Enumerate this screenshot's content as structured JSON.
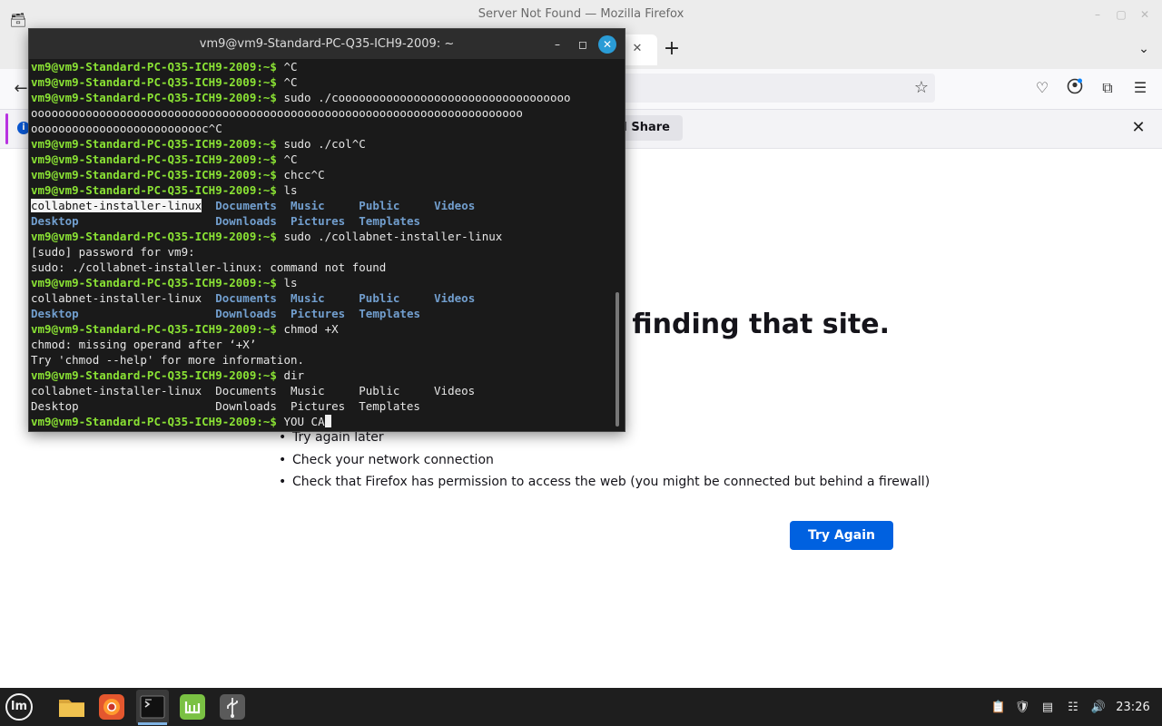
{
  "firefox": {
    "window_title": "Server Not Found — Mozilla Firefox",
    "notification_button": "t I Share",
    "error_title": "le finding that site.",
    "suggestions": [
      "Try again later",
      "Check your network connection",
      "Check that Firefox has permission to access the web (you might be connected but behind a firewall)"
    ],
    "try_again_label": "Try Again"
  },
  "terminal": {
    "title": "vm9@vm9-Standard-PC-Q35-ICH9-2009: ~",
    "prompt": "vm9@vm9-Standard-PC-Q35-ICH9-2009:~$ ",
    "lines": [
      {
        "segments": [
          {
            "t": "vm9@vm9-Standard-PC-Q35-ICH9-2009:~$ ",
            "k": "prompt"
          },
          {
            "t": "^C"
          }
        ]
      },
      {
        "segments": [
          {
            "t": "vm9@vm9-Standard-PC-Q35-ICH9-2009:~$ ",
            "k": "prompt"
          },
          {
            "t": "^C"
          }
        ]
      },
      {
        "segments": [
          {
            "t": "vm9@vm9-Standard-PC-Q35-ICH9-2009:~$ ",
            "k": "prompt"
          },
          {
            "t": "sudo ./coooooooooooooooooooooooooooooooooo"
          }
        ]
      },
      {
        "segments": [
          {
            "t": "oooooooooooooooooooooooooooooooooooooooooooooooooooooooooooooooooooooooo"
          }
        ]
      },
      {
        "segments": [
          {
            "t": "oooooooooooooooooooooooooc^C"
          }
        ]
      },
      {
        "segments": [
          {
            "t": "vm9@vm9-Standard-PC-Q35-ICH9-2009:~$ ",
            "k": "prompt"
          },
          {
            "t": "sudo ./col^C"
          }
        ]
      },
      {
        "segments": [
          {
            "t": "vm9@vm9-Standard-PC-Q35-ICH9-2009:~$ ",
            "k": "prompt"
          },
          {
            "t": "^C"
          }
        ]
      },
      {
        "segments": [
          {
            "t": "vm9@vm9-Standard-PC-Q35-ICH9-2009:~$ ",
            "k": "prompt"
          },
          {
            "t": "chcc^C"
          }
        ]
      },
      {
        "segments": [
          {
            "t": "vm9@vm9-Standard-PC-Q35-ICH9-2009:~$ ",
            "k": "prompt"
          },
          {
            "t": "ls"
          }
        ]
      },
      {
        "segments": [
          {
            "t": "collabnet-installer-linux",
            "k": "hl"
          },
          {
            "t": "  "
          },
          {
            "t": "Documents",
            "k": "dir"
          },
          {
            "t": "  "
          },
          {
            "t": "Music",
            "k": "dir"
          },
          {
            "t": "     "
          },
          {
            "t": "Public",
            "k": "dir"
          },
          {
            "t": "     "
          },
          {
            "t": "Videos",
            "k": "dir"
          }
        ]
      },
      {
        "segments": [
          {
            "t": "Desktop",
            "k": "dir"
          },
          {
            "t": "                    "
          },
          {
            "t": "Downloads",
            "k": "dir"
          },
          {
            "t": "  "
          },
          {
            "t": "Pictures",
            "k": "dir"
          },
          {
            "t": "  "
          },
          {
            "t": "Templates",
            "k": "dir"
          }
        ]
      },
      {
        "segments": [
          {
            "t": "vm9@vm9-Standard-PC-Q35-ICH9-2009:~$ ",
            "k": "prompt"
          },
          {
            "t": "sudo ./collabnet-installer-linux"
          }
        ]
      },
      {
        "segments": [
          {
            "t": "[sudo] password for vm9:"
          }
        ]
      },
      {
        "segments": [
          {
            "t": "sudo: ./collabnet-installer-linux: command not found"
          }
        ]
      },
      {
        "segments": [
          {
            "t": "vm9@vm9-Standard-PC-Q35-ICH9-2009:~$ ",
            "k": "prompt"
          },
          {
            "t": "ls"
          }
        ]
      },
      {
        "segments": [
          {
            "t": "collabnet-installer-linux  "
          },
          {
            "t": "Documents",
            "k": "dir"
          },
          {
            "t": "  "
          },
          {
            "t": "Music",
            "k": "dir"
          },
          {
            "t": "     "
          },
          {
            "t": "Public",
            "k": "dir"
          },
          {
            "t": "     "
          },
          {
            "t": "Videos",
            "k": "dir"
          }
        ]
      },
      {
        "segments": [
          {
            "t": "Desktop",
            "k": "dir"
          },
          {
            "t": "                    "
          },
          {
            "t": "Downloads",
            "k": "dir"
          },
          {
            "t": "  "
          },
          {
            "t": "Pictures",
            "k": "dir"
          },
          {
            "t": "  "
          },
          {
            "t": "Templates",
            "k": "dir"
          }
        ]
      },
      {
        "segments": [
          {
            "t": "vm9@vm9-Standard-PC-Q35-ICH9-2009:~$ ",
            "k": "prompt"
          },
          {
            "t": "chmod +X"
          }
        ]
      },
      {
        "segments": [
          {
            "t": "chmod: missing operand after ‘+X’"
          }
        ]
      },
      {
        "segments": [
          {
            "t": "Try 'chmod --help' for more information."
          }
        ]
      },
      {
        "segments": [
          {
            "t": "vm9@vm9-Standard-PC-Q35-ICH9-2009:~$ ",
            "k": "prompt"
          },
          {
            "t": "dir"
          }
        ]
      },
      {
        "segments": [
          {
            "t": "collabnet-installer-linux  Documents  Music     Public     Videos"
          }
        ]
      },
      {
        "segments": [
          {
            "t": "Desktop                    Downloads  Pictures  Templates"
          }
        ]
      }
    ],
    "current_input": "YOU CA"
  },
  "taskbar": {
    "menu_logo_text": "lm",
    "launchers": [
      "files-icon",
      "firefox-icon",
      "terminal-icon",
      "mint-update-icon",
      "usb-icon"
    ],
    "clock": "23:26"
  },
  "colors": {
    "prompt_green": "#8ae234",
    "dir_blue": "#729fcf",
    "firefox_button_blue": "#0061e0",
    "terminal_close_blue": "#2a9cd6"
  }
}
